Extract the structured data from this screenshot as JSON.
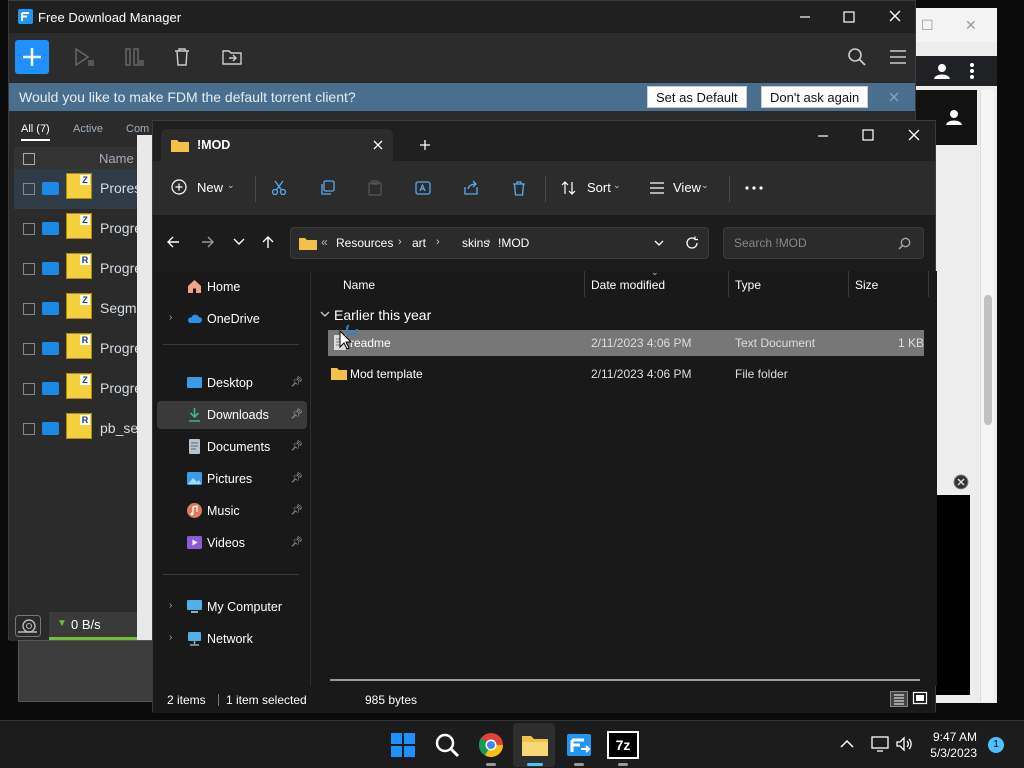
{
  "fdm": {
    "title": "Free Download Manager",
    "banner_text": "Would you like to make FDM the default torrent client?",
    "set_default": "Set as Default",
    "dont_ask": "Don't ask again",
    "tabs": [
      "All (7)",
      "Active",
      "Com"
    ],
    "column_name": "Name",
    "rows": [
      {
        "name": "Prores",
        "badge": "Z"
      },
      {
        "name": "Progre",
        "badge": "Z"
      },
      {
        "name": "Progre",
        "badge": "R"
      },
      {
        "name": "Segme",
        "badge": "Z"
      },
      {
        "name": "Progre",
        "badge": "R"
      },
      {
        "name": "Progre",
        "badge": "Z"
      },
      {
        "name": "pb_se",
        "badge": "R"
      }
    ],
    "speed": "0 B/s"
  },
  "explorer": {
    "tab_title": "!MOD",
    "new_label": "New",
    "sort_label": "Sort",
    "view_label": "View",
    "breadcrumb_prefix": "«",
    "breadcrumb": [
      "Resources",
      "art",
      "skins",
      "!MOD"
    ],
    "search_placeholder": "Search !MOD",
    "sidebar": [
      {
        "label": "Home",
        "icon": "home-icon"
      },
      {
        "label": "OneDrive",
        "icon": "cloud-icon"
      },
      {
        "label": "Desktop",
        "icon": "desktop-icon"
      },
      {
        "label": "Downloads",
        "icon": "download-icon"
      },
      {
        "label": "Documents",
        "icon": "document-icon"
      },
      {
        "label": "Pictures",
        "icon": "picture-icon"
      },
      {
        "label": "Music",
        "icon": "music-icon"
      },
      {
        "label": "Videos",
        "icon": "video-icon"
      },
      {
        "label": "My Computer",
        "icon": "computer-icon"
      },
      {
        "label": "Network",
        "icon": "network-icon"
      }
    ],
    "columns": {
      "name": "Name",
      "date": "Date modified",
      "type": "Type",
      "size": "Size"
    },
    "group": "Earlier this year",
    "files": [
      {
        "name": "readme",
        "date": "2/11/2023 4:06 PM",
        "type": "Text Document",
        "size": "1 KB"
      },
      {
        "name": "Mod template",
        "date": "2/11/2023 4:06 PM",
        "type": "File folder",
        "size": ""
      }
    ],
    "status": {
      "items": "2 items",
      "selected": "1 item selected",
      "bytes": "985 bytes"
    }
  },
  "taskbar": {
    "time": "9:47 AM",
    "date": "5/3/2023",
    "notification_count": "1",
    "sevenzip_label": "7z"
  },
  "colors": {
    "accent": "#1e90ff",
    "selection": "#777777",
    "banner": "#4a6f8e"
  }
}
